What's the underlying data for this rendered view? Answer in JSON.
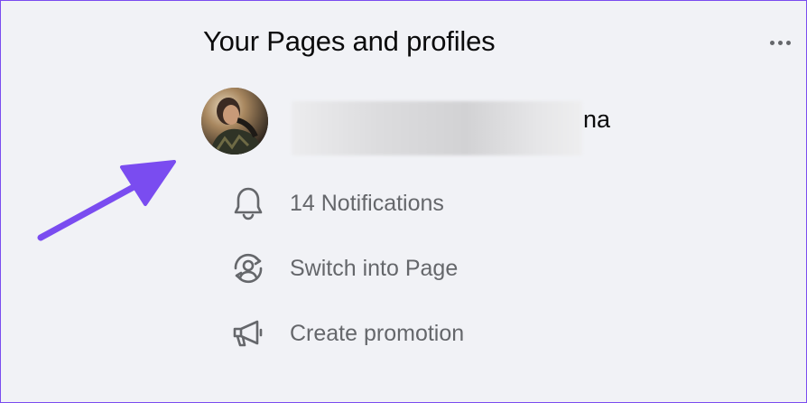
{
  "header": {
    "title": "Your Pages and profiles",
    "more_icon": "more-horizontal-icon"
  },
  "profile": {
    "name_visible_suffix": "na",
    "name_redacted": true
  },
  "menu": [
    {
      "icon": "bell-icon",
      "label": "14 Notifications"
    },
    {
      "icon": "switch-profile-icon",
      "label": "Switch into Page"
    },
    {
      "icon": "megaphone-icon",
      "label": "Create promotion"
    }
  ],
  "colors": {
    "background": "#f1f2f6",
    "border": "#7a4cf0",
    "title_text": "#0b0b0c",
    "menu_text": "#65676b",
    "annotation_arrow": "#7a4cf0"
  }
}
